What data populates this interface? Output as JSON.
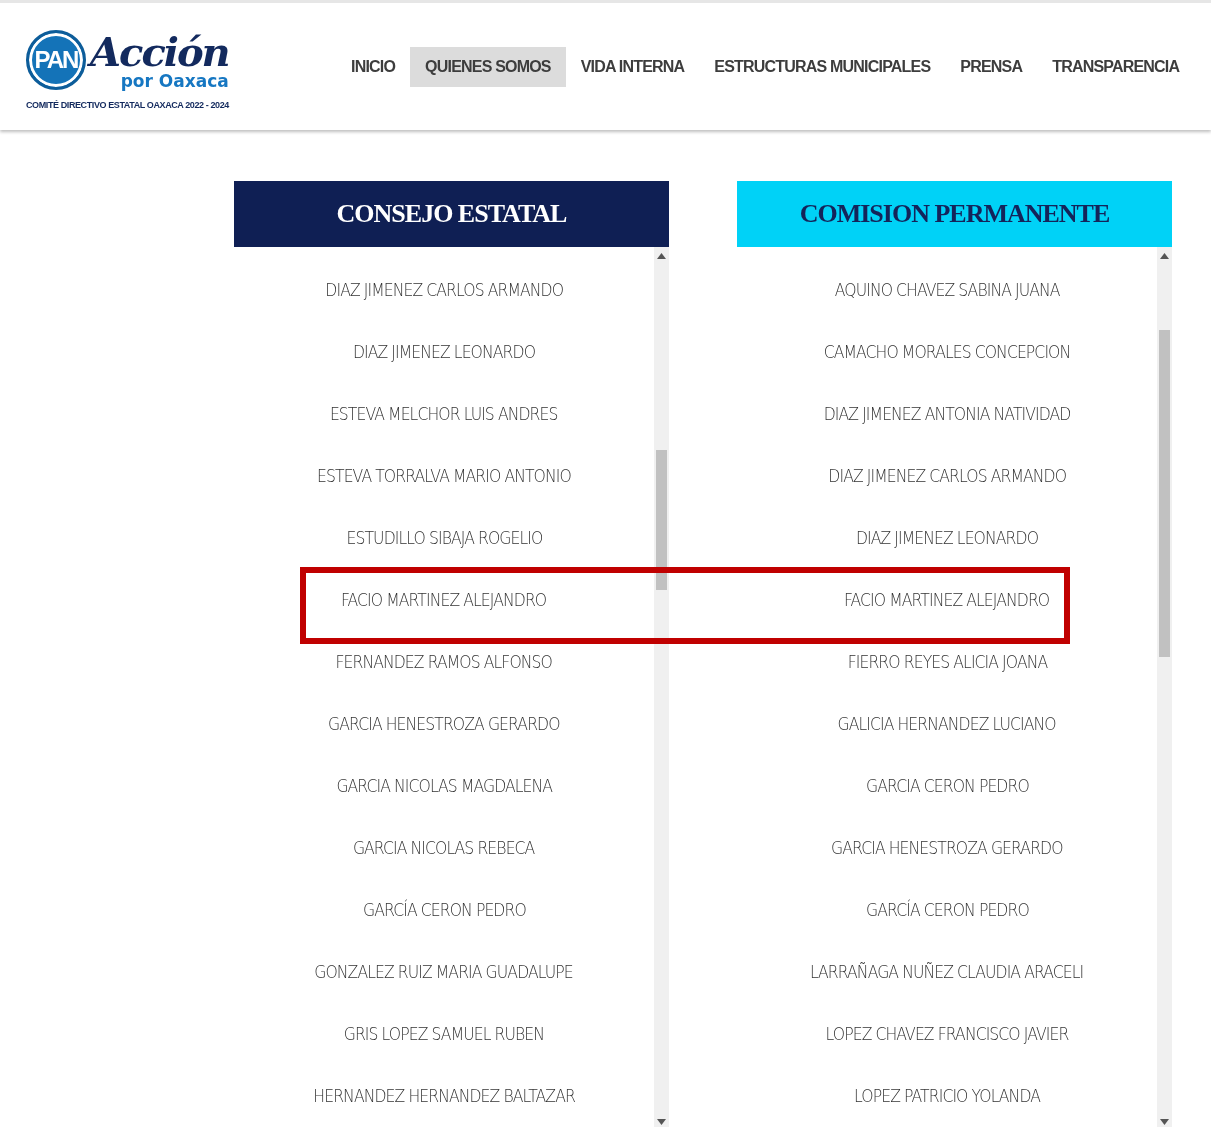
{
  "logo": {
    "mark": "PAN",
    "script": "Acción",
    "place": "por Oaxaca",
    "subtitle": "COMITÉ DIRECTIVO ESTATAL OAXACA 2022 - 2024"
  },
  "nav": [
    {
      "label": "INICIO",
      "selected": false
    },
    {
      "label": "QUIENES SOMOS",
      "selected": true
    },
    {
      "label": "VIDA INTERNA",
      "selected": false
    },
    {
      "label": "ESTRUCTURAS MUNICIPALES",
      "selected": false
    },
    {
      "label": "PRENSA",
      "selected": false
    },
    {
      "label": "TRANSPARENCIA",
      "selected": false
    }
  ],
  "panels": [
    {
      "title": "CONSEJO ESTATAL",
      "kind": "dark",
      "members": [
        {
          "name": "DIAZ JIMENEZ CARLOS ARMANDO",
          "highlighted": false
        },
        {
          "name": "DIAZ JIMENEZ LEONARDO",
          "highlighted": false
        },
        {
          "name": "ESTEVA MELCHOR LUIS ANDRES",
          "highlighted": false
        },
        {
          "name": "ESTEVA TORRALVA MARIO ANTONIO",
          "highlighted": false
        },
        {
          "name": "ESTUDILLO SIBAJA ROGELIO",
          "highlighted": false
        },
        {
          "name": "FACIO MARTINEZ ALEJANDRO",
          "highlighted": true
        },
        {
          "name": "FERNANDEZ RAMOS ALFONSO",
          "highlighted": false
        },
        {
          "name": "GARCIA HENESTROZA GERARDO",
          "highlighted": false
        },
        {
          "name": "GARCIA NICOLAS MAGDALENA",
          "highlighted": false
        },
        {
          "name": "GARCIA NICOLAS REBECA",
          "highlighted": false
        },
        {
          "name": "GARCÍA CERON PEDRO",
          "highlighted": false
        },
        {
          "name": "GONZALEZ RUIZ MARIA GUADALUPE",
          "highlighted": false
        },
        {
          "name": "GRIS LOPEZ SAMUEL RUBEN",
          "highlighted": false
        },
        {
          "name": "HERNANDEZ HERNANDEZ BALTAZAR",
          "highlighted": false
        }
      ]
    },
    {
      "title": "COMISION PERMANENTE",
      "kind": "light",
      "members": [
        {
          "name": "AQUINO CHAVEZ SABINA JUANA",
          "highlighted": false
        },
        {
          "name": "CAMACHO MORALES CONCEPCION",
          "highlighted": false
        },
        {
          "name": "DIAZ JIMENEZ ANTONIA NATIVIDAD",
          "highlighted": false
        },
        {
          "name": "DIAZ JIMENEZ CARLOS ARMANDO",
          "highlighted": false
        },
        {
          "name": "DIAZ JIMENEZ LEONARDO",
          "highlighted": false
        },
        {
          "name": "FACIO MARTINEZ ALEJANDRO",
          "highlighted": true
        },
        {
          "name": "FIERRO REYES ALICIA JOANA",
          "highlighted": false
        },
        {
          "name": "GALICIA HERNANDEZ LUCIANO",
          "highlighted": false
        },
        {
          "name": "GARCIA CERON PEDRO",
          "highlighted": false
        },
        {
          "name": "GARCIA HENESTROZA GERARDO",
          "highlighted": false
        },
        {
          "name": "GARCÍA CERON PEDRO",
          "highlighted": false
        },
        {
          "name": "LARRAÑAGA NUÑEZ CLAUDIA ARACELI",
          "highlighted": false
        },
        {
          "name": "LOPEZ CHAVEZ FRANCISCO JAVIER",
          "highlighted": false
        },
        {
          "name": "LOPEZ PATRICIO YOLANDA",
          "highlighted": false
        }
      ]
    }
  ]
}
